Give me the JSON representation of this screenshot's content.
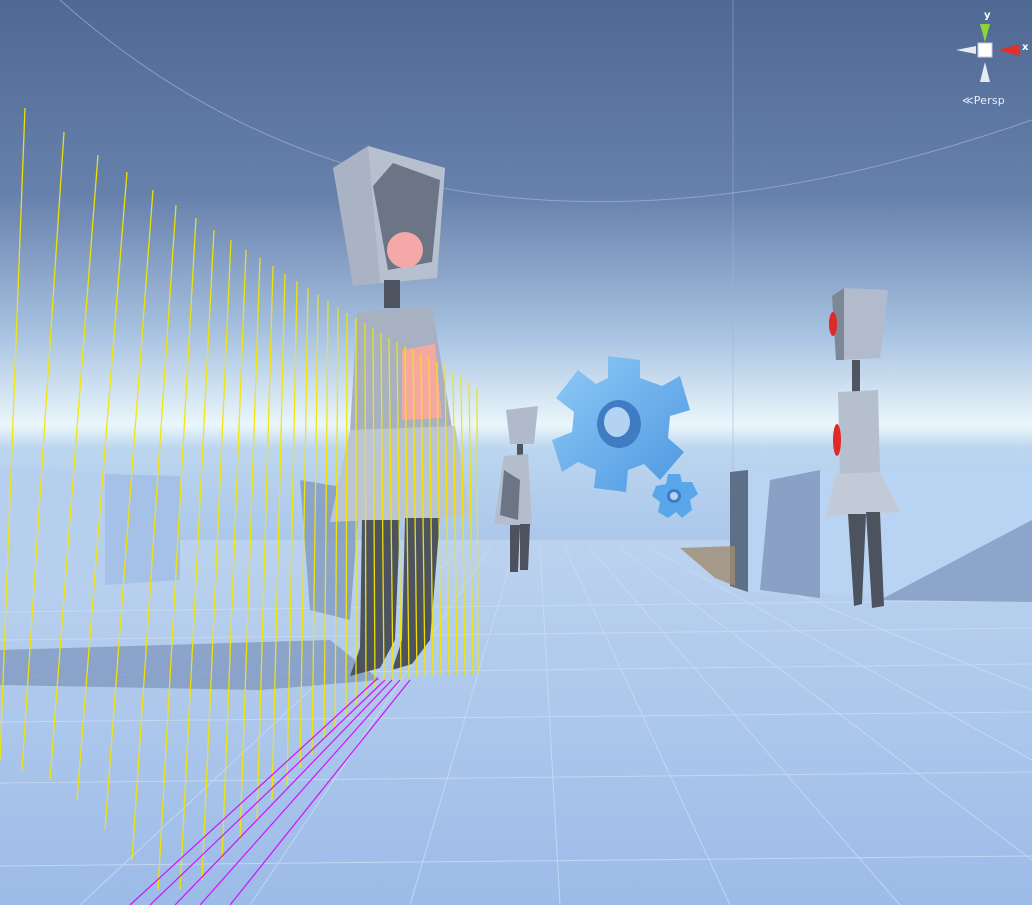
{
  "scene_view": {
    "gizmo": {
      "axis_y_label": "y",
      "axis_x_label": "x",
      "projection_label": "Persp",
      "projection_icon": "perspective-toggle-icon"
    },
    "colors": {
      "sky_top": "#56709d",
      "sky_horizon": "#e9f5fb",
      "ground": "#a9c6ec",
      "grid_line": "#c9dcf4",
      "yellow_gizmo": "#f3e600",
      "magenta_gizmo": "#d200ff",
      "gear_blue": "#5aa6ea",
      "character_body": "#a8b2c2",
      "character_highlight_pink": "#f5a8a8",
      "character_eye_red": "#e02a2a",
      "axis_y_green": "#8ed33a",
      "axis_x_red": "#e0302a"
    },
    "objects": [
      "character-robot-large",
      "character-robot-distant",
      "character-robot-right",
      "gear-large",
      "gear-small",
      "wall-block-left",
      "wall-block-right",
      "yellow-gizmo-fence"
    ]
  }
}
